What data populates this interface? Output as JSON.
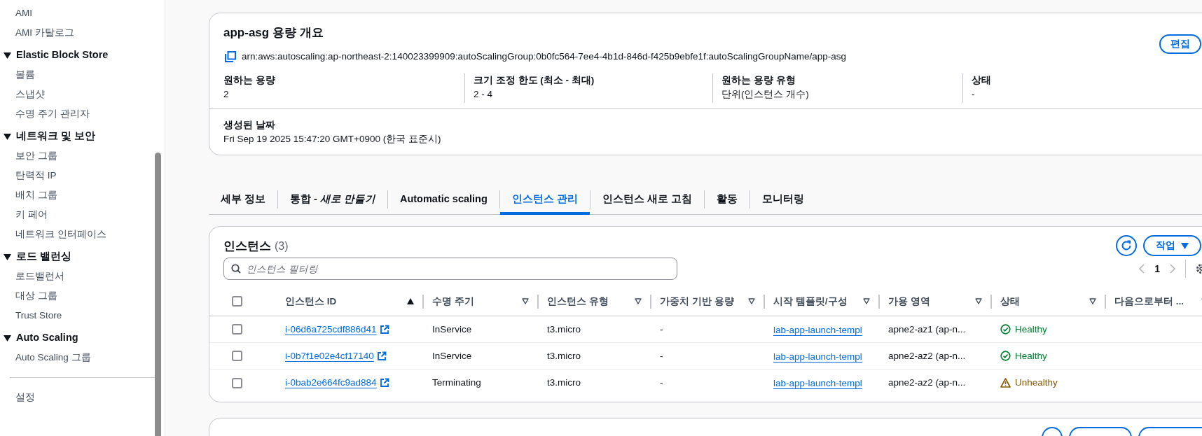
{
  "sidebar": {
    "items": [
      {
        "kind": "link",
        "label": "AMI"
      },
      {
        "kind": "link",
        "label": "AMI 카탈로그"
      },
      {
        "kind": "section",
        "label": "Elastic Block Store",
        "expanded": true,
        "children": [
          {
            "label": "볼륨"
          },
          {
            "label": "스냅샷"
          },
          {
            "label": "수명 주기 관리자"
          }
        ]
      },
      {
        "kind": "section",
        "label": "네트워크 및 보안",
        "expanded": true,
        "children": [
          {
            "label": "보안 그룹"
          },
          {
            "label": "탄력적 IP"
          },
          {
            "label": "배치 그룹"
          },
          {
            "label": "키 페어"
          },
          {
            "label": "네트워크 인터페이스"
          }
        ]
      },
      {
        "kind": "section",
        "label": "로드 밸런싱",
        "expanded": true,
        "children": [
          {
            "label": "로드밸런서"
          },
          {
            "label": "대상 그룹"
          },
          {
            "label": "Trust Store"
          }
        ]
      },
      {
        "kind": "section",
        "label": "Auto Scaling",
        "expanded": true,
        "children": [
          {
            "label": "Auto Scaling 그룹"
          }
        ]
      },
      {
        "kind": "divider"
      },
      {
        "kind": "link",
        "label": "설정"
      }
    ]
  },
  "capacity": {
    "title": "app-asg 용량 개요",
    "edit_button": "편집",
    "arn": "arn:aws:autoscaling:ap-northeast-2:140023399909:autoScalingGroup:0b0fc564-7ee4-4b1d-846d-f425b9ebfe1f:autoScalingGroupName/app-asg",
    "fields": [
      {
        "label": "원하는 용량",
        "value": "2"
      },
      {
        "label": "크기 조정 한도 (최소 - 최대)",
        "value": "2 - 4"
      },
      {
        "label": "원하는 용량 유형",
        "value": "단위(인스턴스 개수)"
      },
      {
        "label": "상태",
        "value": "-"
      }
    ],
    "created": {
      "label": "생성된 날짜",
      "value": "Fri Sep 19 2025 15:47:20 GMT+0900 (한국 표준시)"
    }
  },
  "tabs": [
    {
      "label": "세부 정보",
      "selected": false
    },
    {
      "label": "통합 - *새로 만들기*",
      "selected": false
    },
    {
      "label": "Automatic scaling",
      "selected": false
    },
    {
      "label": "인스턴스 관리",
      "selected": true
    },
    {
      "label": "인스턴스 새로 고침",
      "selected": false
    },
    {
      "label": "활동",
      "selected": false
    },
    {
      "label": "모니터링",
      "selected": false
    }
  ],
  "instances": {
    "title": "인스턴스",
    "count": "(3)",
    "actions_button": "작업",
    "filter": {
      "placeholder": "인스턴스 필터링"
    },
    "page": "1",
    "all_checked": false,
    "columns": [
      {
        "label": "인스턴스 ID",
        "kind": "sorted"
      },
      {
        "label": "수명 주기",
        "kind": "sortable"
      },
      {
        "label": "인스턴스 유형",
        "kind": "sortable"
      },
      {
        "label": "가중치 기반 용량",
        "kind": "sortable"
      },
      {
        "label": "시작 템플릿/구성",
        "kind": "sortable"
      },
      {
        "label": "가용 영역",
        "kind": "sortable"
      },
      {
        "label": "상태",
        "kind": "sortable"
      },
      {
        "label": "다음으로부터 ...",
        "kind": "sortable"
      }
    ],
    "rows": [
      {
        "checked": false,
        "id": "i-06d6a725cdf886d41",
        "lifecycle": "InService",
        "type": "t3.micro",
        "weight": "-",
        "template": "lab-app-launch-templ",
        "zone": "apne2-az1 (ap-n...",
        "health": "Healthy",
        "kind": "healthy"
      },
      {
        "checked": false,
        "id": "i-0b7f1e02e4cf17140",
        "lifecycle": "InService",
        "type": "t3.micro",
        "weight": "-",
        "template": "lab-app-launch-templ",
        "zone": "apne2-az2 (ap-n...",
        "health": "Healthy",
        "kind": "healthy"
      },
      {
        "checked": false,
        "id": "i-0bab2e664fc9ad884",
        "lifecycle": "Terminating",
        "type": "t3.micro",
        "weight": "-",
        "template": "lab-app-launch-templ",
        "zone": "apne2-az2 (ap-n...",
        "health": "Unhealthy",
        "kind": "unhealthy"
      }
    ]
  },
  "hooks": {
    "kind": "panel"
  }
}
